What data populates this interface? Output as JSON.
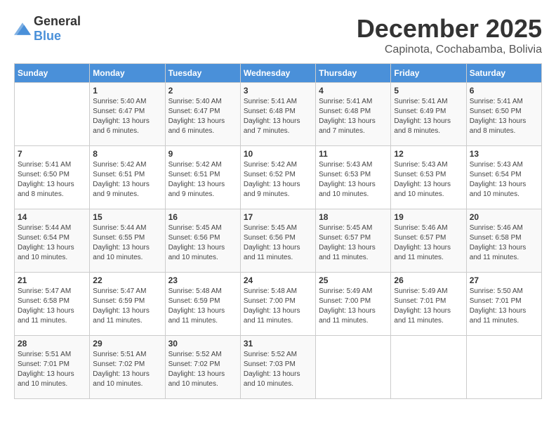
{
  "header": {
    "logo_general": "General",
    "logo_blue": "Blue",
    "month": "December 2025",
    "location": "Capinota, Cochabamba, Bolivia"
  },
  "calendar": {
    "days_of_week": [
      "Sunday",
      "Monday",
      "Tuesday",
      "Wednesday",
      "Thursday",
      "Friday",
      "Saturday"
    ],
    "weeks": [
      [
        {
          "day": "",
          "info": ""
        },
        {
          "day": "1",
          "info": "Sunrise: 5:40 AM\nSunset: 6:47 PM\nDaylight: 13 hours\nand 6 minutes."
        },
        {
          "day": "2",
          "info": "Sunrise: 5:40 AM\nSunset: 6:47 PM\nDaylight: 13 hours\nand 6 minutes."
        },
        {
          "day": "3",
          "info": "Sunrise: 5:41 AM\nSunset: 6:48 PM\nDaylight: 13 hours\nand 7 minutes."
        },
        {
          "day": "4",
          "info": "Sunrise: 5:41 AM\nSunset: 6:48 PM\nDaylight: 13 hours\nand 7 minutes."
        },
        {
          "day": "5",
          "info": "Sunrise: 5:41 AM\nSunset: 6:49 PM\nDaylight: 13 hours\nand 8 minutes."
        },
        {
          "day": "6",
          "info": "Sunrise: 5:41 AM\nSunset: 6:50 PM\nDaylight: 13 hours\nand 8 minutes."
        }
      ],
      [
        {
          "day": "7",
          "info": "Sunrise: 5:41 AM\nSunset: 6:50 PM\nDaylight: 13 hours\nand 8 minutes."
        },
        {
          "day": "8",
          "info": "Sunrise: 5:42 AM\nSunset: 6:51 PM\nDaylight: 13 hours\nand 9 minutes."
        },
        {
          "day": "9",
          "info": "Sunrise: 5:42 AM\nSunset: 6:51 PM\nDaylight: 13 hours\nand 9 minutes."
        },
        {
          "day": "10",
          "info": "Sunrise: 5:42 AM\nSunset: 6:52 PM\nDaylight: 13 hours\nand 9 minutes."
        },
        {
          "day": "11",
          "info": "Sunrise: 5:43 AM\nSunset: 6:53 PM\nDaylight: 13 hours\nand 10 minutes."
        },
        {
          "day": "12",
          "info": "Sunrise: 5:43 AM\nSunset: 6:53 PM\nDaylight: 13 hours\nand 10 minutes."
        },
        {
          "day": "13",
          "info": "Sunrise: 5:43 AM\nSunset: 6:54 PM\nDaylight: 13 hours\nand 10 minutes."
        }
      ],
      [
        {
          "day": "14",
          "info": "Sunrise: 5:44 AM\nSunset: 6:54 PM\nDaylight: 13 hours\nand 10 minutes."
        },
        {
          "day": "15",
          "info": "Sunrise: 5:44 AM\nSunset: 6:55 PM\nDaylight: 13 hours\nand 10 minutes."
        },
        {
          "day": "16",
          "info": "Sunrise: 5:45 AM\nSunset: 6:56 PM\nDaylight: 13 hours\nand 10 minutes."
        },
        {
          "day": "17",
          "info": "Sunrise: 5:45 AM\nSunset: 6:56 PM\nDaylight: 13 hours\nand 11 minutes."
        },
        {
          "day": "18",
          "info": "Sunrise: 5:45 AM\nSunset: 6:57 PM\nDaylight: 13 hours\nand 11 minutes."
        },
        {
          "day": "19",
          "info": "Sunrise: 5:46 AM\nSunset: 6:57 PM\nDaylight: 13 hours\nand 11 minutes."
        },
        {
          "day": "20",
          "info": "Sunrise: 5:46 AM\nSunset: 6:58 PM\nDaylight: 13 hours\nand 11 minutes."
        }
      ],
      [
        {
          "day": "21",
          "info": "Sunrise: 5:47 AM\nSunset: 6:58 PM\nDaylight: 13 hours\nand 11 minutes."
        },
        {
          "day": "22",
          "info": "Sunrise: 5:47 AM\nSunset: 6:59 PM\nDaylight: 13 hours\nand 11 minutes."
        },
        {
          "day": "23",
          "info": "Sunrise: 5:48 AM\nSunset: 6:59 PM\nDaylight: 13 hours\nand 11 minutes."
        },
        {
          "day": "24",
          "info": "Sunrise: 5:48 AM\nSunset: 7:00 PM\nDaylight: 13 hours\nand 11 minutes."
        },
        {
          "day": "25",
          "info": "Sunrise: 5:49 AM\nSunset: 7:00 PM\nDaylight: 13 hours\nand 11 minutes."
        },
        {
          "day": "26",
          "info": "Sunrise: 5:49 AM\nSunset: 7:01 PM\nDaylight: 13 hours\nand 11 minutes."
        },
        {
          "day": "27",
          "info": "Sunrise: 5:50 AM\nSunset: 7:01 PM\nDaylight: 13 hours\nand 11 minutes."
        }
      ],
      [
        {
          "day": "28",
          "info": "Sunrise: 5:51 AM\nSunset: 7:01 PM\nDaylight: 13 hours\nand 10 minutes."
        },
        {
          "day": "29",
          "info": "Sunrise: 5:51 AM\nSunset: 7:02 PM\nDaylight: 13 hours\nand 10 minutes."
        },
        {
          "day": "30",
          "info": "Sunrise: 5:52 AM\nSunset: 7:02 PM\nDaylight: 13 hours\nand 10 minutes."
        },
        {
          "day": "31",
          "info": "Sunrise: 5:52 AM\nSunset: 7:03 PM\nDaylight: 13 hours\nand 10 minutes."
        },
        {
          "day": "",
          "info": ""
        },
        {
          "day": "",
          "info": ""
        },
        {
          "day": "",
          "info": ""
        }
      ]
    ]
  }
}
